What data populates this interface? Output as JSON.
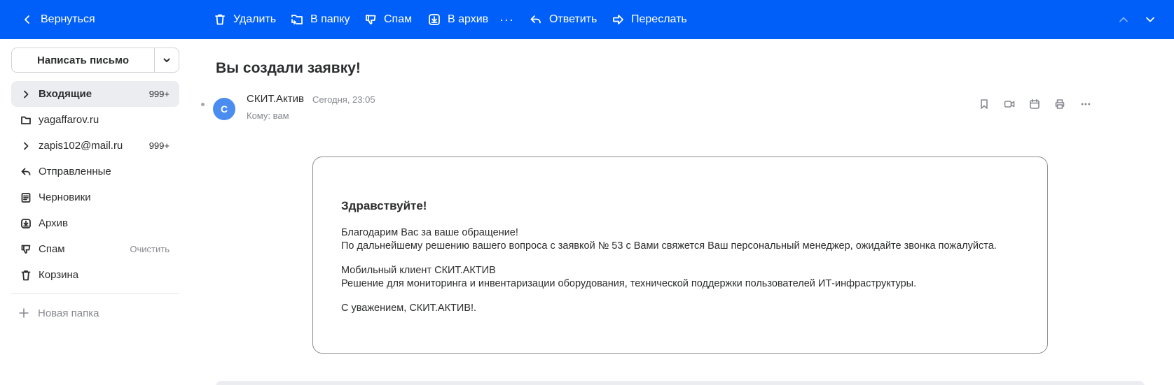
{
  "toolbar": {
    "back_label": "Вернуться",
    "delete_label": "Удалить",
    "move_label": "В папку",
    "spam_label": "Спам",
    "archive_label": "В архив",
    "more_label": "···",
    "reply_label": "Ответить",
    "forward_label": "Переслать"
  },
  "sidebar": {
    "compose_label": "Написать письмо",
    "folders": [
      {
        "label": "Входящие",
        "count": "999+",
        "icon": "chevron-right-icon"
      },
      {
        "label": "yagaffarov.ru",
        "count": "",
        "icon": "folder-icon"
      },
      {
        "label": "zapis102@mail.ru",
        "count": "999+",
        "icon": "chevron-right-icon"
      },
      {
        "label": "Отправленные",
        "count": "",
        "icon": "sent-icon"
      },
      {
        "label": "Черновики",
        "count": "",
        "icon": "draft-icon"
      },
      {
        "label": "Архив",
        "count": "",
        "icon": "archive-icon"
      },
      {
        "label": "Спам",
        "action": "Очистить",
        "icon": "spam-icon"
      },
      {
        "label": "Корзина",
        "count": "",
        "icon": "trash-icon"
      }
    ],
    "new_folder_label": "Новая папка"
  },
  "message": {
    "subject": "Вы создали заявку!",
    "avatar_letter": "С",
    "sender": "СКИТ.Актив",
    "date": "Сегодня, 23:05",
    "to": "Кому: вам",
    "body": {
      "greeting": "Здравствуйте!",
      "p1_line1": "Благодарим Вас за ваше обращение!",
      "p1_line2": "По дальнейшему решению вашего вопроса с заявкой № 53 с Вами свяжется Ваш персональный менеджер, ожидайте звонка пожалуйста.",
      "p2_line1": "Мобильный клиент СКИТ.АКТИВ",
      "p2_line2": "Решение для мониторинга и инвентаризации оборудования, технической поддержки пользователей ИТ-инфраструктуры.",
      "p3_line1": "С уважением, СКИТ.АКТИВ!."
    }
  },
  "colors": {
    "toolbar_bg": "#005ff9",
    "active_folder_bg": "#ebedf0",
    "avatar_bg": "#4a8cf0"
  }
}
